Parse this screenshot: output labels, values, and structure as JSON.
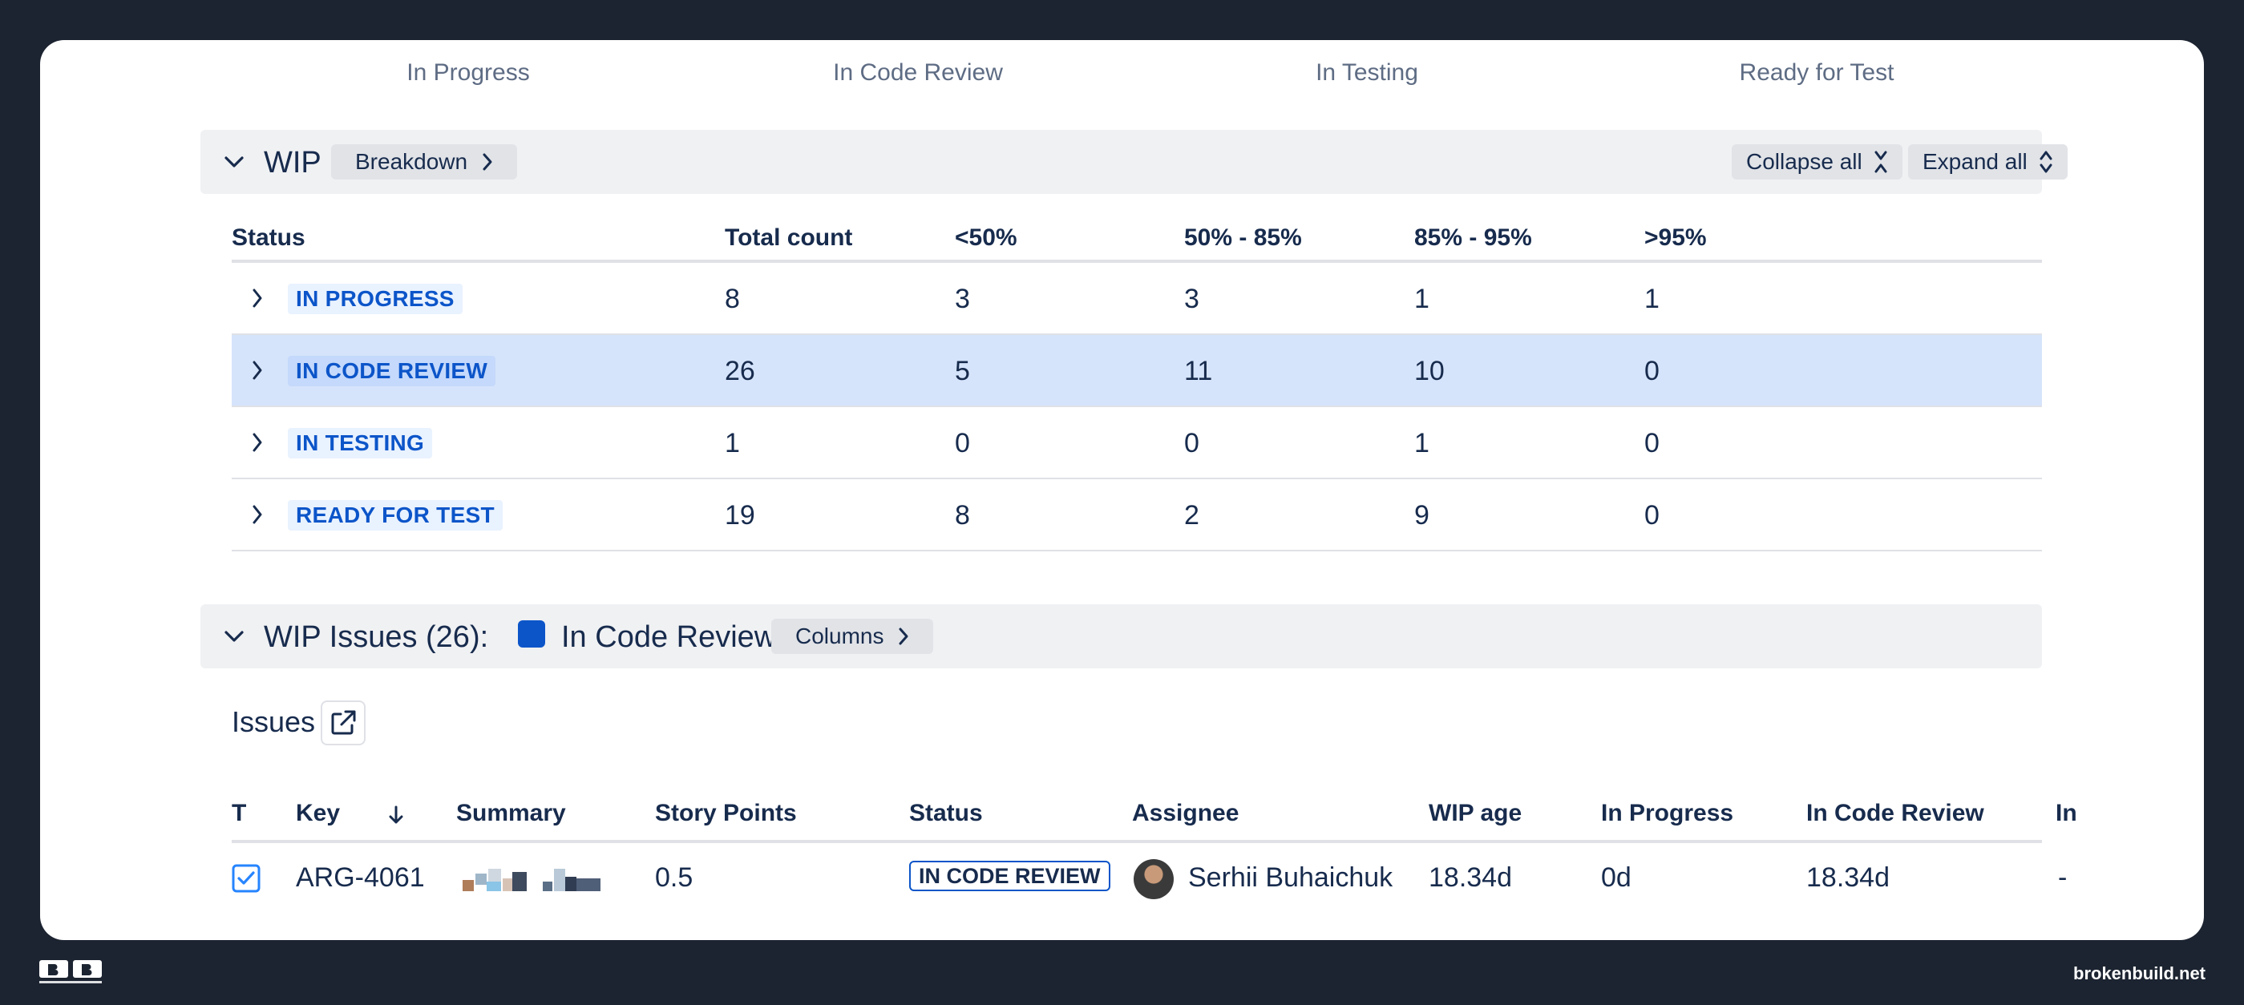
{
  "top_status": {
    "labels": [
      "In Progress",
      "In Code Review",
      "In Testing",
      "Ready for Test"
    ]
  },
  "wip": {
    "title": "WIP",
    "breakdown_label": "Breakdown",
    "collapse_all_label": "Collapse all",
    "expand_all_label": "Expand all",
    "columns": [
      "Status",
      "Total count",
      "<50%",
      "50% - 85%",
      "85% - 95%",
      ">95%"
    ],
    "rows": [
      {
        "status": "IN PROGRESS",
        "total": "8",
        "lt50": "3",
        "p50_85": "3",
        "p85_95": "1",
        "gt95": "1"
      },
      {
        "status": "IN CODE REVIEW",
        "total": "26",
        "lt50": "5",
        "p50_85": "11",
        "p85_95": "10",
        "gt95": "0"
      },
      {
        "status": "IN TESTING",
        "total": "1",
        "lt50": "0",
        "p50_85": "0",
        "p85_95": "1",
        "gt95": "0"
      },
      {
        "status": "READY FOR TEST",
        "total": "19",
        "lt50": "8",
        "p50_85": "2",
        "p85_95": "9",
        "gt95": "0"
      }
    ]
  },
  "wip_issues": {
    "title": "WIP Issues (26):",
    "status_label": "In Code Review",
    "status_color": "#0c55c9",
    "columns_label": "Columns",
    "issues_title": "Issues",
    "table_columns": [
      "T",
      "Key",
      "Summary",
      "Story Points",
      "Status",
      "Assignee",
      "WIP age",
      "In Progress",
      "In Code Review",
      "In"
    ],
    "rows": [
      {
        "key": "ARG-4061",
        "story_points": "0.5",
        "status": "IN CODE REVIEW",
        "assignee": "Serhii Buhaichuk",
        "wip_age": "18.34d",
        "in_progress": "0d",
        "in_code_review": "18.34d",
        "in_next": "-"
      }
    ]
  },
  "footer": {
    "site": "brokenbuild.net"
  },
  "colors": {
    "background": "#1c2431",
    "accent": "#0c55c9",
    "selected_row": "#d6e4fb"
  }
}
